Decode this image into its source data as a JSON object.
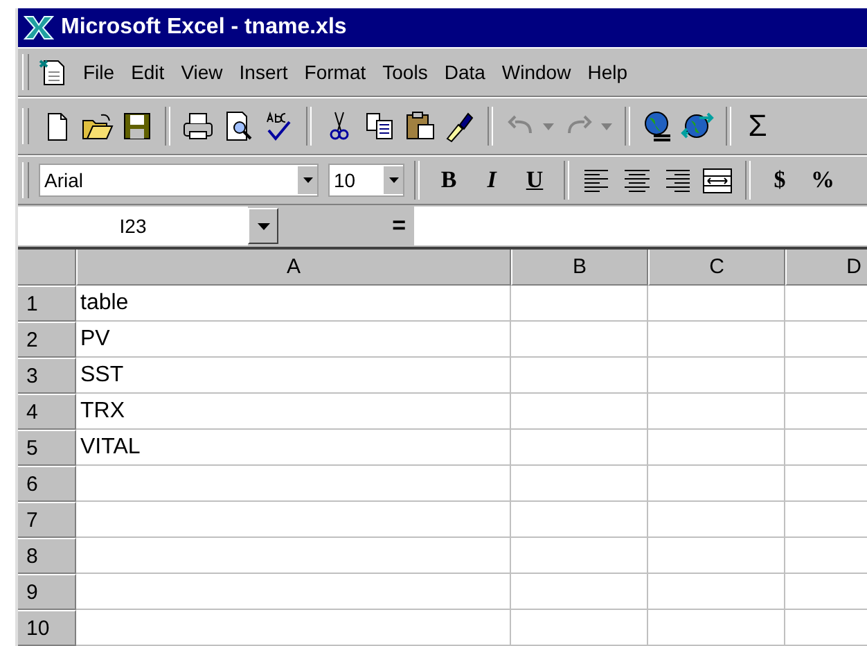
{
  "window": {
    "title": "Microsoft Excel - tname.xls"
  },
  "menu_bar": [
    "File",
    "Edit",
    "View",
    "Insert",
    "Format",
    "Tools",
    "Data",
    "Window",
    "Help"
  ],
  "standard_toolbar": [
    {
      "kind": "new",
      "disabled": false
    },
    {
      "kind": "open",
      "disabled": false
    },
    {
      "kind": "save",
      "disabled": false
    },
    {
      "kind": "separator",
      "disabled": false
    },
    {
      "kind": "print",
      "disabled": false
    },
    {
      "kind": "preview",
      "disabled": false
    },
    {
      "kind": "spelling",
      "disabled": false
    },
    {
      "kind": "separator",
      "disabled": false
    },
    {
      "kind": "cut",
      "disabled": false
    },
    {
      "kind": "copy",
      "disabled": false
    },
    {
      "kind": "paste",
      "disabled": false
    },
    {
      "kind": "painter",
      "disabled": false
    },
    {
      "kind": "separator",
      "disabled": false
    },
    {
      "kind": "undo",
      "disabled": true
    },
    {
      "kind": "caret",
      "disabled": true
    },
    {
      "kind": "redo",
      "disabled": true
    },
    {
      "kind": "caret",
      "disabled": true
    },
    {
      "kind": "separator",
      "disabled": false
    },
    {
      "kind": "globe",
      "disabled": false
    },
    {
      "kind": "globe-arrows",
      "disabled": false
    },
    {
      "kind": "separator",
      "disabled": false
    },
    {
      "kind": "text",
      "label": "Σ",
      "disabled": false
    }
  ],
  "formatting_toolbar": {
    "font": "Arial",
    "size": "10",
    "buttons": [
      {
        "kind": "bold",
        "label": "B"
      },
      {
        "kind": "italic",
        "label": "I"
      },
      {
        "kind": "underline",
        "label": "U"
      },
      {
        "kind": "separator"
      },
      {
        "kind": "align-left"
      },
      {
        "kind": "align-center"
      },
      {
        "kind": "align-right"
      },
      {
        "kind": "merge"
      },
      {
        "kind": "separator"
      },
      {
        "kind": "text",
        "label": "$"
      },
      {
        "kind": "text",
        "label": "%"
      }
    ]
  },
  "formula_bar": {
    "name_box": "I23",
    "equals": "="
  },
  "sheet": {
    "columns": [
      "A",
      "B",
      "C",
      "D"
    ],
    "rows": [
      {
        "number": "1",
        "value": "table"
      },
      {
        "number": "2",
        "value": "PV"
      },
      {
        "number": "3",
        "value": "SST"
      },
      {
        "number": "4",
        "value": "TRX"
      },
      {
        "number": "5",
        "value": "VITAL"
      },
      {
        "number": "6"
      },
      {
        "number": "7"
      },
      {
        "number": "8"
      },
      {
        "number": "9"
      },
      {
        "number": "10"
      }
    ]
  }
}
